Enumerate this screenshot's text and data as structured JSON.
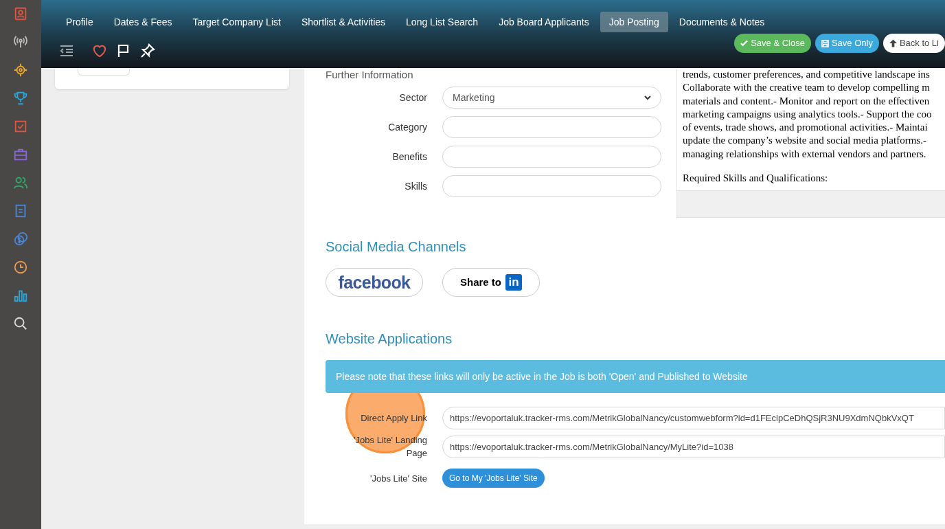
{
  "tabs": [
    {
      "label": "Profile",
      "selected": false
    },
    {
      "label": "Dates & Fees",
      "selected": false
    },
    {
      "label": "Target Company List",
      "selected": false
    },
    {
      "label": "Shortlist & Activities",
      "selected": false
    },
    {
      "label": "Long List Search",
      "selected": false
    },
    {
      "label": "Job Board Applicants",
      "selected": false
    },
    {
      "label": "Job Posting",
      "selected": true
    },
    {
      "label": "Documents & Notes",
      "selected": false
    }
  ],
  "actions": [
    {
      "label": "Save & Close",
      "kind": "success"
    },
    {
      "label": "Save Only",
      "kind": "info"
    },
    {
      "label": "Back to Li",
      "kind": "plain"
    }
  ],
  "further_information": {
    "title": "Further Information",
    "fields": [
      {
        "label": "Sector",
        "kind": "select",
        "value": "Marketing"
      },
      {
        "label": "Category",
        "kind": "text"
      },
      {
        "label": "Benefits",
        "kind": "text"
      },
      {
        "label": "Skills",
        "kind": "text"
      }
    ]
  },
  "description": {
    "lines": [
      "trends, customer preferences, and competitive landscape ins",
      "Collaborate with the creative team to develop compelling m",
      "materials and content.- Monitor and report on the effectiven",
      "marketing campaigns using analytics tools.- Support the coo",
      "of events, trade shows, and promotional activities.- Maintai",
      "update the company’s website and social media platforms.-",
      "managing relationships with external vendors and partners."
    ],
    "subheading": "Required Skills and Qualifications:"
  },
  "social_media": {
    "title": "Social Media Channels",
    "buttons": [
      {
        "kind": "facebook",
        "label": "facebook"
      },
      {
        "kind": "linkedin",
        "label": "Share to",
        "badge": "in"
      }
    ]
  },
  "website_applications": {
    "title": "Website Applications",
    "notice": "Please note that these links will only be active in the Job is both 'Open' and Published to Website",
    "rows": [
      {
        "label": "Direct Apply Link",
        "kind": "link",
        "value": "https://evoportaluk.tracker-rms.com/MetrikGlobalNancy/customwebform?id=d1FEclpCeDhQSjR3NU9XdmNQbkVxQT"
      },
      {
        "label": "'Jobs Lite' Landing Page",
        "kind": "link",
        "value": "https://evoportaluk.tracker-rms.com/MetrikGlobalNancy/MyLite?id=1038"
      },
      {
        "label": "'Jobs Lite' Site",
        "kind": "button",
        "value": "Go to My 'Jobs Lite' Site"
      }
    ]
  }
}
